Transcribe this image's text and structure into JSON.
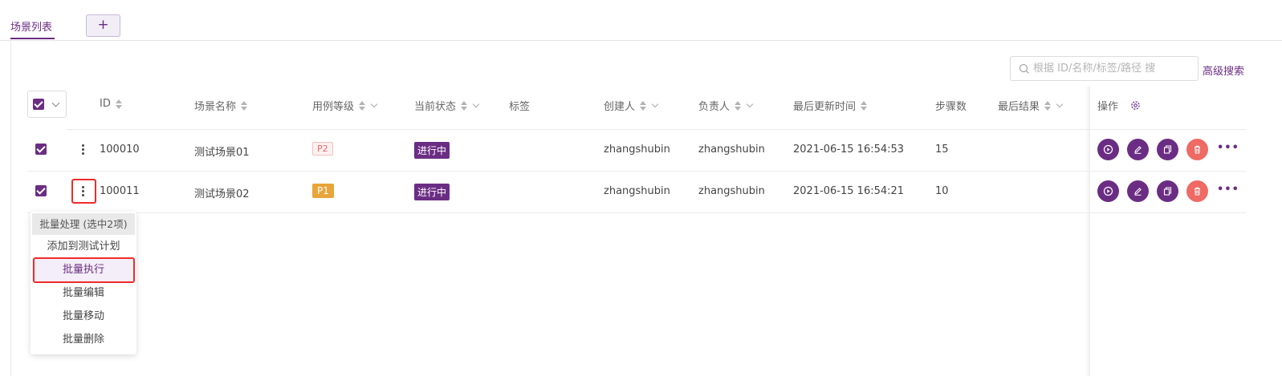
{
  "tabs": {
    "active_label": "场景列表",
    "add_label": "+"
  },
  "search": {
    "placeholder": "根据 ID/名称/标签/路径 搜",
    "advanced_label": "高级搜索"
  },
  "table": {
    "columns": {
      "id": "ID",
      "name": "场景名称",
      "level": "用例等级",
      "status": "当前状态",
      "tags": "标签",
      "creator": "创建人",
      "owner": "负责人",
      "updated": "最后更新时间",
      "steps": "步骤数",
      "last_result": "最后结果",
      "ops": "操作"
    },
    "rows": [
      {
        "id": "100010",
        "name": "测试场景01",
        "level": "P2",
        "status": "进行中",
        "tags": "",
        "creator": "zhangshubin",
        "owner": "zhangshubin",
        "updated": "2021-06-15 16:54:53",
        "steps": "15",
        "last_result": "",
        "checked": true
      },
      {
        "id": "100011",
        "name": "测试场景02",
        "level": "P1",
        "status": "进行中",
        "tags": "",
        "creator": "zhangshubin",
        "owner": "zhangshubin",
        "updated": "2021-06-15 16:54:21",
        "steps": "10",
        "last_result": "",
        "checked": true
      }
    ],
    "row_more_label": "•••"
  },
  "batch_menu": {
    "header": "批量处理 (选中2项)",
    "items": [
      "添加到测试计划",
      "批量执行",
      "批量编辑",
      "批量移动",
      "批量删除"
    ],
    "highlighted_item": "批量执行"
  },
  "icons": {
    "search": "search-icon",
    "settings": "gear-icon",
    "run": "play-circle-icon",
    "edit": "pencil-icon",
    "copy": "copy-icon",
    "delete": "trash-icon",
    "more": "kebab-icon"
  },
  "colors": {
    "brand": "#6b2d83",
    "level_p1": "#e9a43a",
    "level_p2": "#e86b6b",
    "delete": "#ef6a64",
    "annotation_red": "#f02b2b"
  }
}
